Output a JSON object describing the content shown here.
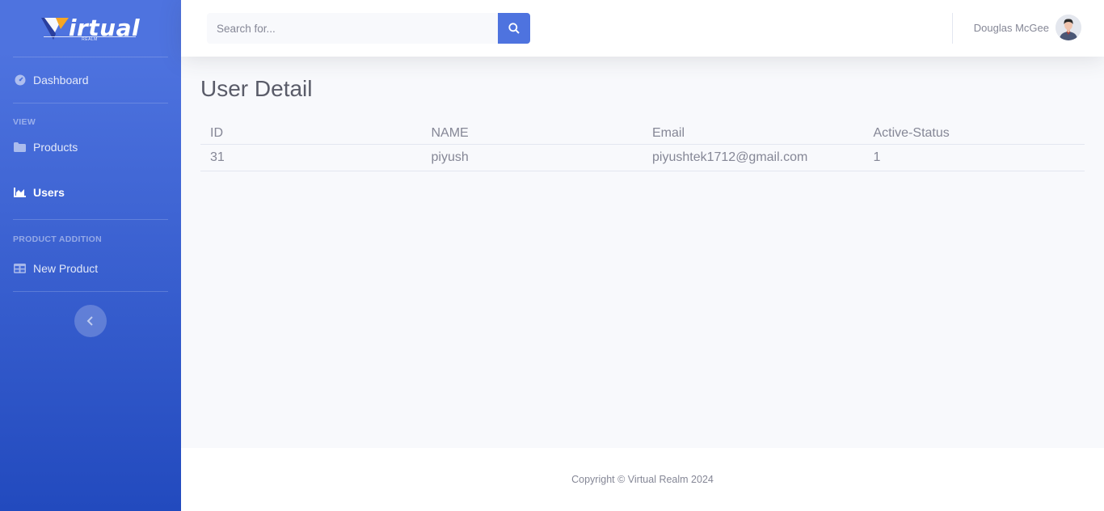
{
  "brand": {
    "name": "irtual",
    "sub": "REALM"
  },
  "sidebar": {
    "items": [
      {
        "label": "Dashboard",
        "icon": "tachometer-icon"
      },
      {
        "label": "Products",
        "icon": "folder-icon"
      },
      {
        "label": "Users",
        "icon": "area-chart-icon"
      },
      {
        "label": "New Product",
        "icon": "table-icon"
      }
    ],
    "headings": [
      "VIEW",
      "PRODUCT ADDITION"
    ]
  },
  "search": {
    "placeholder": "Search for..."
  },
  "user": {
    "name": "Douglas McGee"
  },
  "main": {
    "title": "User Detail",
    "table": {
      "columns": [
        "ID",
        "NAME",
        "Email",
        "Active-Status"
      ],
      "rows": [
        [
          "31",
          "piyush",
          "piyushtek1712@gmail.com",
          "1"
        ]
      ]
    }
  },
  "footer": {
    "text": "Copyright © Virtual Realm 2024"
  },
  "colors": {
    "primary": "#4e73df",
    "primary_dark": "#224abe",
    "text": "#858796",
    "heading": "#5a5c69",
    "accent": "#f6a623"
  }
}
